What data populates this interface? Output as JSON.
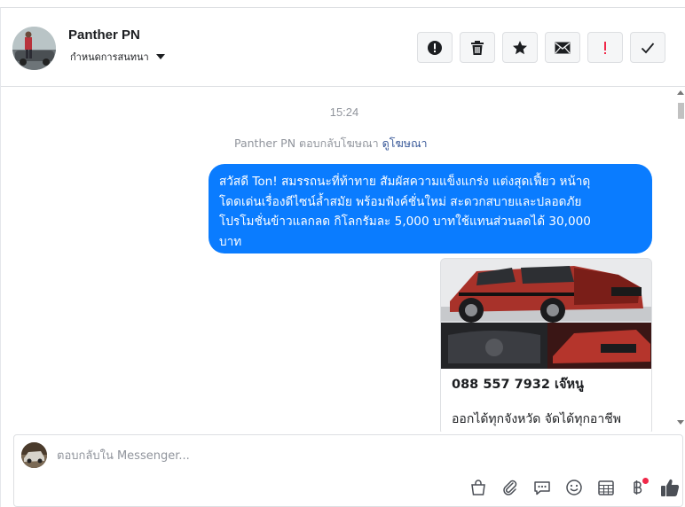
{
  "header": {
    "contact_name": "Panther PN",
    "assign_label": "กำหนดการสนทนา",
    "actions": [
      {
        "name": "mark-spam-button",
        "icon": "exclamation-circle-icon"
      },
      {
        "name": "delete-button",
        "icon": "trash-icon"
      },
      {
        "name": "star-button",
        "icon": "star-icon"
      },
      {
        "name": "mark-unread-button",
        "icon": "envelope-icon"
      },
      {
        "name": "follow-up-button",
        "icon": "red-exclamation-icon"
      },
      {
        "name": "mark-done-button",
        "icon": "checkmark-icon"
      }
    ]
  },
  "conversation": {
    "timestamp": "15:24",
    "reply_note_prefix": "Panther PN ตอบกลับโฆษณา",
    "reply_note_link": "ดูโฆษณา",
    "message_lines": [
      "สวัสดี Ton! สมรรถนะที่ท้าทาย สัมผัสความแข็งแกร่ง แต่งสุดเฟี้ยว หน้าดุ",
      "โดดเด่นเรื่องดีไซน์ล้ำสมัย พร้อมฟังค์ชั่นใหม่ สะดวกสบายและปลอดภัย",
      "โปรโมชั่นข้าวแลกลด กิโลกรัมละ 5,000 บาทใช้แทนส่วนลดได้ 30,000",
      "บาท"
    ],
    "ad_card": {
      "title": "088 557 7932 เจ๊หนู",
      "description": "ออกได้ทุกจังหวัด จัดได้ทุกอาชีพ"
    }
  },
  "composer": {
    "placeholder": "ตอบกลับใน Messenger...",
    "tools": [
      "shopping-bag-icon",
      "paperclip-icon",
      "saved-reply-icon",
      "emoji-icon",
      "appointment-icon",
      "payment-baht-icon",
      "thumbs-up-icon"
    ]
  },
  "colors": {
    "bubble_blue": "#0a7cff",
    "link": "#385898",
    "muted_text": "#90949c",
    "alert_red": "#f02849",
    "like_icon": "#4b4f56"
  }
}
